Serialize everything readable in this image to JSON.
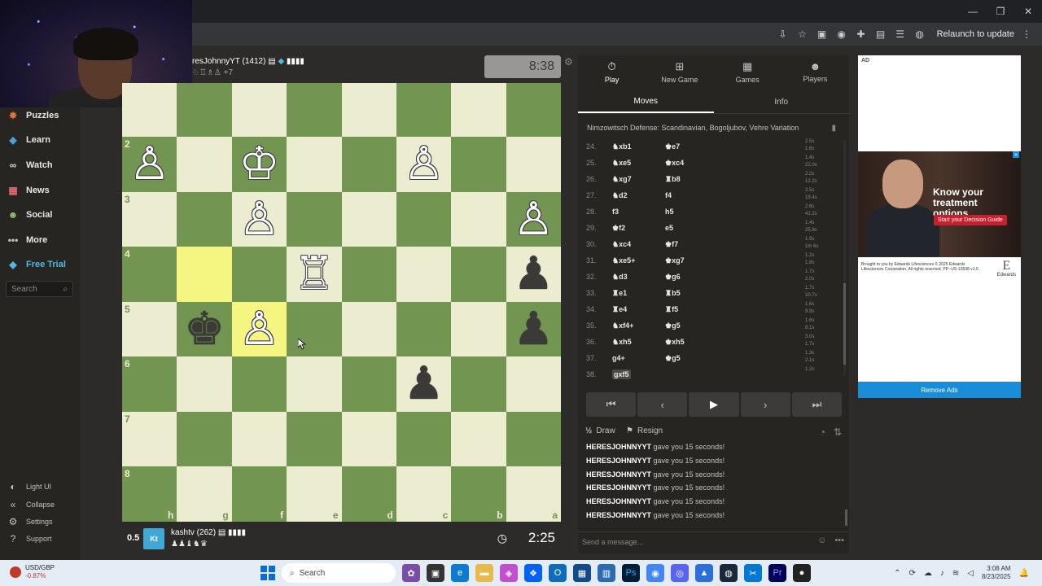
{
  "browser": {
    "relaunch_label": "Relaunch to update"
  },
  "sidebar": {
    "items": [
      {
        "label": "Puzzles",
        "icon": "puzzle-icon",
        "color": "#e4763c"
      },
      {
        "label": "Learn",
        "icon": "graduation-icon",
        "color": "#4d9fd6"
      },
      {
        "label": "Watch",
        "icon": "binoculars-icon",
        "color": "#d8d8d8"
      },
      {
        "label": "News",
        "icon": "newspaper-icon",
        "color": "#e06b6b"
      },
      {
        "label": "Social",
        "icon": "people-icon",
        "color": "#8cc46b"
      },
      {
        "label": "More",
        "icon": "ellipsis-icon",
        "color": "#c3c2c1"
      },
      {
        "label": "Free Trial",
        "icon": "diamond-icon",
        "color": "#4fb8e6"
      }
    ],
    "search_placeholder": "Search",
    "bottom_items": [
      {
        "label": "Light UI",
        "icon": "half-circle-icon"
      },
      {
        "label": "Collapse",
        "icon": "collapse-icon"
      },
      {
        "label": "Settings",
        "icon": "gear-icon"
      },
      {
        "label": "Support",
        "icon": "help-icon"
      }
    ]
  },
  "opponent": {
    "name": "resJohnnyYT (1412)",
    "captures_more": "+7",
    "clock": "8:38"
  },
  "me": {
    "score": "0.5",
    "avatar_text": "Kt",
    "name": "kashtv (262)",
    "clock": "2:25"
  },
  "board": {
    "files": [
      "h",
      "g",
      "f",
      "e",
      "d",
      "c",
      "b",
      "a"
    ],
    "ranks": [
      "",
      "2",
      "3",
      "4",
      "5",
      "6",
      "7",
      "8"
    ],
    "light_color": "#ebecd0",
    "dark_color": "#739552",
    "highlight_squares": [
      "g4",
      "f5"
    ],
    "pieces": [
      {
        "sq": "h2",
        "piece": "pawn",
        "color": "white"
      },
      {
        "sq": "f2",
        "piece": "king",
        "color": "white"
      },
      {
        "sq": "c2",
        "piece": "pawn",
        "color": "white"
      },
      {
        "sq": "f3",
        "piece": "pawn",
        "color": "white"
      },
      {
        "sq": "a3",
        "piece": "pawn",
        "color": "white"
      },
      {
        "sq": "e4",
        "piece": "rook",
        "color": "white"
      },
      {
        "sq": "a4",
        "piece": "pawn",
        "color": "black"
      },
      {
        "sq": "g5",
        "piece": "king",
        "color": "black"
      },
      {
        "sq": "f5",
        "piece": "pawn",
        "color": "white"
      },
      {
        "sq": "a5",
        "piece": "pawn",
        "color": "black"
      },
      {
        "sq": "c6",
        "piece": "pawn",
        "color": "black"
      }
    ]
  },
  "panel": {
    "tabs": [
      {
        "label": "Play",
        "icon": "stopwatch-icon"
      },
      {
        "label": "New Game",
        "icon": "plus-square-icon"
      },
      {
        "label": "Games",
        "icon": "grid-icon"
      },
      {
        "label": "Players",
        "icon": "people-icon"
      }
    ],
    "subtabs": [
      "Moves",
      "Info"
    ],
    "opening": "Nimzowitsch Defense: Scandinavian, Bogoljubov, Vehre Variation",
    "moves": [
      {
        "num": "24.",
        "white": "♞xb1",
        "black": "♚e7",
        "wt": "2.5s",
        "bt": "1.6s"
      },
      {
        "num": "25.",
        "white": "♞xe5",
        "black": "♚xc4",
        "wt": "1.4s",
        "bt": "22.0s"
      },
      {
        "num": "26.",
        "white": "♞xg7",
        "black": "♜b8",
        "wt": "2.2s",
        "bt": "12.2s"
      },
      {
        "num": "27.",
        "white": "♞d2",
        "black": "f4",
        "wt": "2.5s",
        "bt": "19.4s"
      },
      {
        "num": "28.",
        "white": "f3",
        "black": "h5",
        "wt": "2.6s",
        "bt": "41.2s"
      },
      {
        "num": "29.",
        "white": "♚f2",
        "black": "e5",
        "wt": "1.4s",
        "bt": "25.8s"
      },
      {
        "num": "30.",
        "white": "♞xc4",
        "black": "♚f7",
        "wt": "1.9s",
        "bt": "1m 6s"
      },
      {
        "num": "31.",
        "white": "♞xe5+",
        "black": "♚xg7",
        "wt": "1.2s",
        "bt": "1.8s"
      },
      {
        "num": "32.",
        "white": "♞d3",
        "black": "♚g6",
        "wt": "1.7s",
        "bt": "2.0s"
      },
      {
        "num": "33.",
        "white": "♜e1",
        "black": "♜b5",
        "wt": "1.7s",
        "bt": "10.7s"
      },
      {
        "num": "34.",
        "white": "♜e4",
        "black": "♜f5",
        "wt": "1.6s",
        "bt": "9.9s"
      },
      {
        "num": "35.",
        "white": "♞xf4+",
        "black": "♚g5",
        "wt": "1.6s",
        "bt": "8.1s"
      },
      {
        "num": "36.",
        "white": "♞xh5",
        "black": "♚xh5",
        "wt": "3.0s",
        "bt": "1.7s"
      },
      {
        "num": "37.",
        "white": "g4+",
        "black": "♚g5",
        "wt": "1.3s",
        "bt": "2.1s"
      },
      {
        "num": "38.",
        "white": "gxf5",
        "black": "",
        "wt": "1.2s",
        "bt": ""
      }
    ],
    "draw_label": "Draw",
    "resign_label": "Resign",
    "chat": [
      {
        "user": "HERESJOHNNYYT",
        "text": " gave you 15 seconds!"
      },
      {
        "user": "HERESJOHNNYYT",
        "text": " gave you 15 seconds!"
      },
      {
        "user": "HERESJOHNNYYT",
        "text": " gave you 15 seconds!"
      },
      {
        "user": "HERESJOHNNYYT",
        "text": " gave you 15 seconds!"
      },
      {
        "user": "HERESJOHNNYYT",
        "text": " gave you 15 seconds!"
      },
      {
        "user": "HERESJOHNNYYT",
        "text": " gave you 15 seconds!"
      }
    ],
    "chat_placeholder": "Send a message..."
  },
  "ad": {
    "label": "AD",
    "headline": "Know your treatment options",
    "cta": "Start your Decision Guide",
    "fine_print": "Brought to you by Edwards Lifesciences © 2025 Edwards Lifesciences Corporation. All rights reserved. PP--US-10538 v1.0",
    "logo_text": "Edwards",
    "remove_label": "Remove Ads"
  },
  "taskbar": {
    "ticker_name": "USD/GBP",
    "ticker_change": "-0.87%",
    "search_label": "Search",
    "time": "3:08 AM",
    "date": "8/23/2025"
  }
}
